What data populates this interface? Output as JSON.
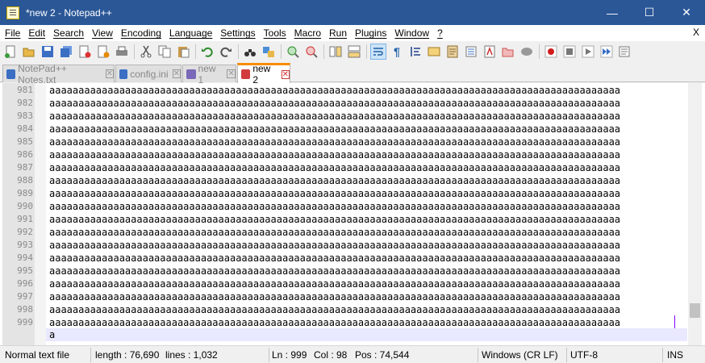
{
  "window": {
    "title": "*new 2 - Notepad++"
  },
  "window_controls": {
    "minimize": "—",
    "maximize": "☐",
    "close": "✕"
  },
  "menu": {
    "items": [
      "File",
      "Edit",
      "Search",
      "View",
      "Encoding",
      "Language",
      "Settings",
      "Tools",
      "Macro",
      "Run",
      "Plugins",
      "Window",
      "?"
    ],
    "close_doc": "X"
  },
  "tabs": [
    {
      "label": "NotePad++ Notes.txt",
      "active": false
    },
    {
      "label": "config.ini",
      "active": false
    },
    {
      "label": "new 1",
      "active": false
    },
    {
      "label": "new 2",
      "active": true
    }
  ],
  "tab_close_glyph": "✕",
  "editor": {
    "line_numbers": [
      "981",
      "982",
      "983",
      "984",
      "985",
      "986",
      "987",
      "988",
      "989",
      "990",
      "991",
      "992",
      "993",
      "994",
      "995",
      "996",
      "997",
      "998",
      "999"
    ],
    "line_text": "aaaaaaaaaaaaaaaaaaaaaaaaaaaaaaaaaaaaaaaaaaaaaaaaaaaaaaaaaaaaaaaaaaaaaaaaaaaaaaaaaaaaaaaaaaaaaaaaaa",
    "wrapped_continuation": "a"
  },
  "status": {
    "file_type": "Normal text file",
    "length": "length : 76,690",
    "lines": "lines : 1,032",
    "ln": "Ln : 999",
    "col": "Col : 98",
    "pos": "Pos : 74,544",
    "eol": "Windows (CR LF)",
    "encoding": "UTF-8",
    "mode": "INS"
  },
  "colors": {
    "titlebar": "#2b5797",
    "active_tab_accent": "#fa8c00",
    "caret": "#8000ff",
    "current_line": "#e8e8ff"
  }
}
